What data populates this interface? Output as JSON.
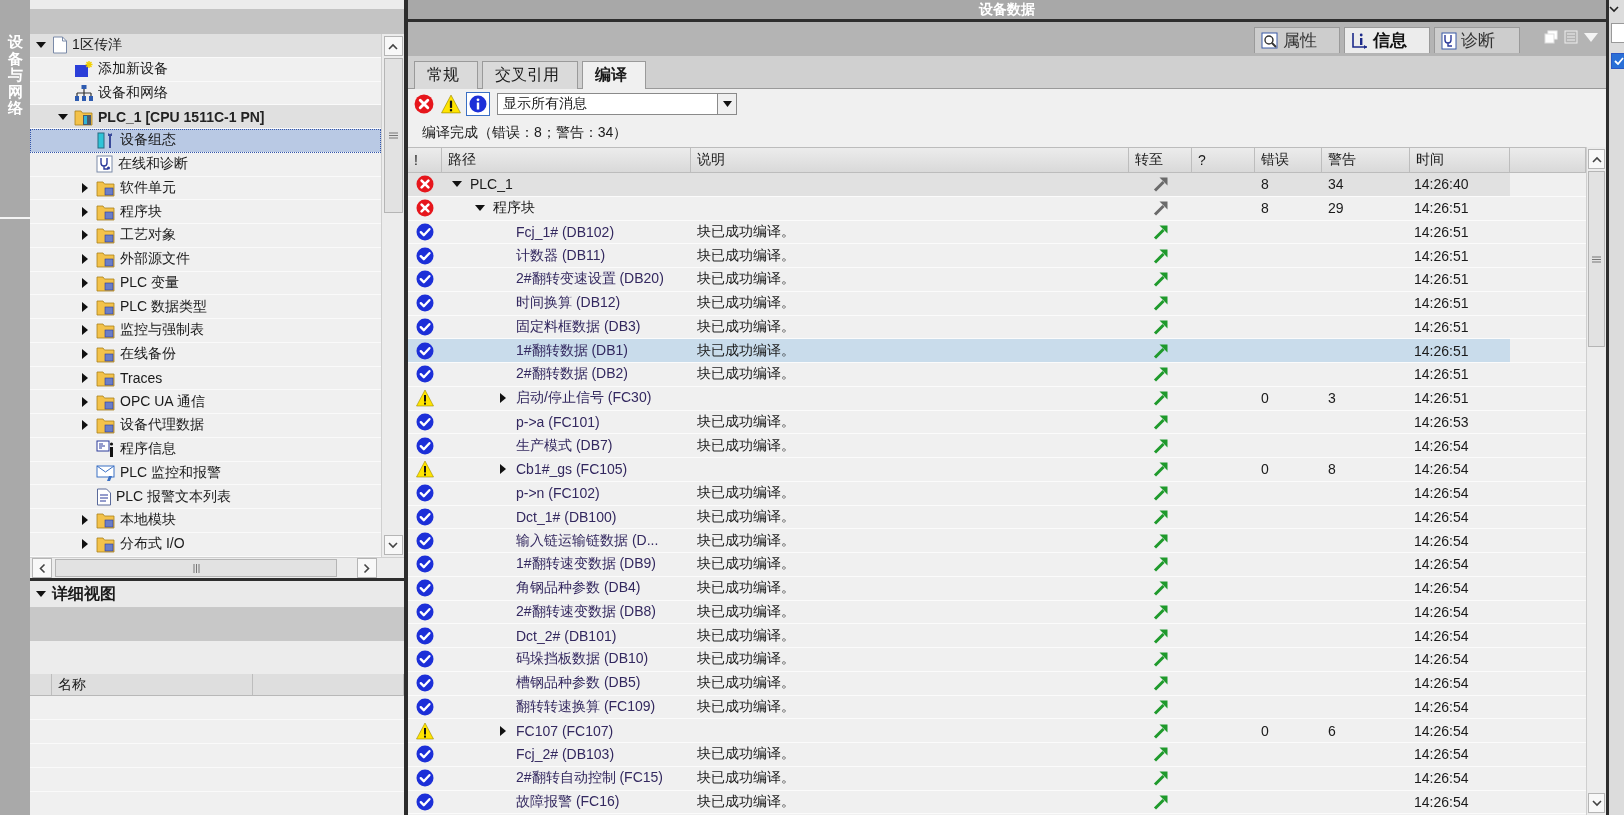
{
  "side_strip": {
    "label": "设备与网络"
  },
  "tree": {
    "items": [
      {
        "label": "1区传洋",
        "kind": "project",
        "expanded": true,
        "selected": false,
        "children": [
          {
            "label": "添加新设备",
            "kind": "add",
            "selected": false
          },
          {
            "label": "设备和网络",
            "kind": "network",
            "selected": false
          },
          {
            "label": "PLC_1 [CPU 1511C-1 PN]",
            "kind": "plc",
            "expanded": true,
            "selected": false,
            "children": [
              {
                "label": "设备组态",
                "kind": "config",
                "selected": true
              },
              {
                "label": "在线和诊断",
                "kind": "diagnostics",
                "selected": false
              },
              {
                "label": "软件单元",
                "kind": "folder",
                "expanded": false,
                "selected": false
              },
              {
                "label": "程序块",
                "kind": "folder",
                "expanded": false,
                "selected": false
              },
              {
                "label": "工艺对象",
                "kind": "folder",
                "expanded": false,
                "selected": false
              },
              {
                "label": "外部源文件",
                "kind": "folder",
                "expanded": false,
                "selected": false
              },
              {
                "label": "PLC 变量",
                "kind": "folder",
                "expanded": false,
                "selected": false
              },
              {
                "label": "PLC 数据类型",
                "kind": "folder",
                "expanded": false,
                "selected": false
              },
              {
                "label": "监控与强制表",
                "kind": "folder",
                "expanded": false,
                "selected": false
              },
              {
                "label": "在线备份",
                "kind": "folder",
                "expanded": false,
                "selected": false
              },
              {
                "label": "Traces",
                "kind": "folder",
                "expanded": false,
                "selected": false
              },
              {
                "label": "OPC UA 通信",
                "kind": "folder",
                "expanded": false,
                "selected": false
              },
              {
                "label": "设备代理数据",
                "kind": "folder",
                "expanded": false,
                "selected": false
              },
              {
                "label": "程序信息",
                "kind": "info",
                "selected": false
              },
              {
                "label": "PLC 监控和报警",
                "kind": "alarm",
                "selected": false
              },
              {
                "label": "PLC 报警文本列表",
                "kind": "textlist",
                "selected": false
              },
              {
                "label": "本地模块",
                "kind": "folder",
                "expanded": false,
                "selected": false
              },
              {
                "label": "分布式 I/O",
                "kind": "folder",
                "expanded": false,
                "selected": false
              }
            ]
          }
        ]
      }
    ]
  },
  "detail_view": {
    "title": "详细视图",
    "expanded": true,
    "columns": [
      "名称"
    ]
  },
  "window": {
    "title": "设备数据"
  },
  "inspector_tabs": [
    {
      "label": "属性",
      "kind": "properties",
      "selected": false
    },
    {
      "label": "信息",
      "kind": "info",
      "selected": true
    },
    {
      "label": "诊断",
      "kind": "diagnostics",
      "selected": false
    }
  ],
  "tabs": [
    {
      "label": "常规",
      "selected": false
    },
    {
      "label": "交叉引用",
      "selected": false
    },
    {
      "label": "编译",
      "selected": true
    }
  ],
  "filters": [
    {
      "kind": "error",
      "selected": false
    },
    {
      "kind": "warning",
      "selected": false
    },
    {
      "kind": "info",
      "selected": true
    }
  ],
  "message_filter": {
    "value": "显示所有消息"
  },
  "status": "编译完成（错误：8；警告：34）",
  "messages": {
    "columns": [
      "!",
      "路径",
      "说明",
      "转至",
      "?",
      "错误",
      "警告",
      "时间"
    ],
    "rows": [
      {
        "kind": "error",
        "path": "PLC_1",
        "errors": "8",
        "warnings": "34",
        "time": "14:26:40",
        "expanded": true,
        "selected": false,
        "children": [
          {
            "kind": "error",
            "path": "程序块",
            "errors": "8",
            "warnings": "29",
            "time": "14:26:51",
            "expanded": true,
            "selected": false,
            "children": [
              {
                "kind": "ok",
                "path": "Fcj_1# (DB102)",
                "description": "块已成功编译。",
                "time": "14:26:51",
                "selected": false
              },
              {
                "kind": "ok",
                "path": "计数器 (DB11)",
                "description": "块已成功编译。",
                "time": "14:26:51",
                "selected": false
              },
              {
                "kind": "ok",
                "path": "2#翻转变速设置 (DB20)",
                "description": "块已成功编译。",
                "time": "14:26:51",
                "selected": false
              },
              {
                "kind": "ok",
                "path": "时间换算 (DB12)",
                "description": "块已成功编译。",
                "time": "14:26:51",
                "selected": false
              },
              {
                "kind": "ok",
                "path": "固定料框数据 (DB3)",
                "description": "块已成功编译。",
                "time": "14:26:51",
                "selected": false
              },
              {
                "kind": "ok",
                "path": "1#翻转数据 (DB1)",
                "description": "块已成功编译。",
                "time": "14:26:51",
                "selected": true
              },
              {
                "kind": "ok",
                "path": "2#翻转数据 (DB2)",
                "description": "块已成功编译。",
                "time": "14:26:51",
                "selected": false
              },
              {
                "kind": "warning",
                "path": "启动/停止信号 (FC30)",
                "errors": "0",
                "warnings": "3",
                "time": "14:26:51",
                "expanded": false,
                "selected": false
              },
              {
                "kind": "ok",
                "path": "p->a (FC101)",
                "description": "块已成功编译。",
                "time": "14:26:53",
                "selected": false
              },
              {
                "kind": "ok",
                "path": "生产模式 (DB7)",
                "description": "块已成功编译。",
                "time": "14:26:54",
                "selected": false
              },
              {
                "kind": "warning",
                "path": "Cb1#_gs (FC105)",
                "errors": "0",
                "warnings": "8",
                "time": "14:26:54",
                "expanded": false,
                "selected": false
              },
              {
                "kind": "ok",
                "path": "p->n (FC102)",
                "description": "块已成功编译。",
                "time": "14:26:54",
                "selected": false
              },
              {
                "kind": "ok",
                "path": "Dct_1# (DB100)",
                "description": "块已成功编译。",
                "time": "14:26:54",
                "selected": false
              },
              {
                "kind": "ok",
                "path": "输入链运输链数据 (D...",
                "description": "块已成功编译。",
                "time": "14:26:54",
                "selected": false
              },
              {
                "kind": "ok",
                "path": "1#翻转速变数据 (DB9)",
                "description": "块已成功编译。",
                "time": "14:26:54",
                "selected": false
              },
              {
                "kind": "ok",
                "path": "角钢品种参数 (DB4)",
                "description": "块已成功编译。",
                "time": "14:26:54",
                "selected": false
              },
              {
                "kind": "ok",
                "path": "2#翻转速变数据 (DB8)",
                "description": "块已成功编译。",
                "time": "14:26:54",
                "selected": false
              },
              {
                "kind": "ok",
                "path": "Dct_2# (DB101)",
                "description": "块已成功编译。",
                "time": "14:26:54",
                "selected": false
              },
              {
                "kind": "ok",
                "path": "码垛挡板数据 (DB10)",
                "description": "块已成功编译。",
                "time": "14:26:54",
                "selected": false
              },
              {
                "kind": "ok",
                "path": "槽钢品种参数 (DB5)",
                "description": "块已成功编译。",
                "time": "14:26:54",
                "selected": false
              },
              {
                "kind": "ok",
                "path": "翻转转速换算 (FC109)",
                "description": "块已成功编译。",
                "time": "14:26:54",
                "selected": false
              },
              {
                "kind": "warning",
                "path": "FC107 (FC107)",
                "errors": "0",
                "warnings": "6",
                "time": "14:26:54",
                "expanded": false,
                "selected": false
              },
              {
                "kind": "ok",
                "path": "Fcj_2# (DB103)",
                "description": "块已成功编译。",
                "time": "14:26:54",
                "selected": false
              },
              {
                "kind": "ok",
                "path": "2#翻转自动控制 (FC15)",
                "description": "块已成功编译。",
                "time": "14:26:54",
                "selected": false
              },
              {
                "kind": "ok",
                "path": "故障报警 (FC16)",
                "description": "块已成功编译。",
                "time": "14:26:54",
                "selected": false
              }
            ]
          }
        ]
      }
    ]
  },
  "side_panel": {
    "checked": true
  }
}
